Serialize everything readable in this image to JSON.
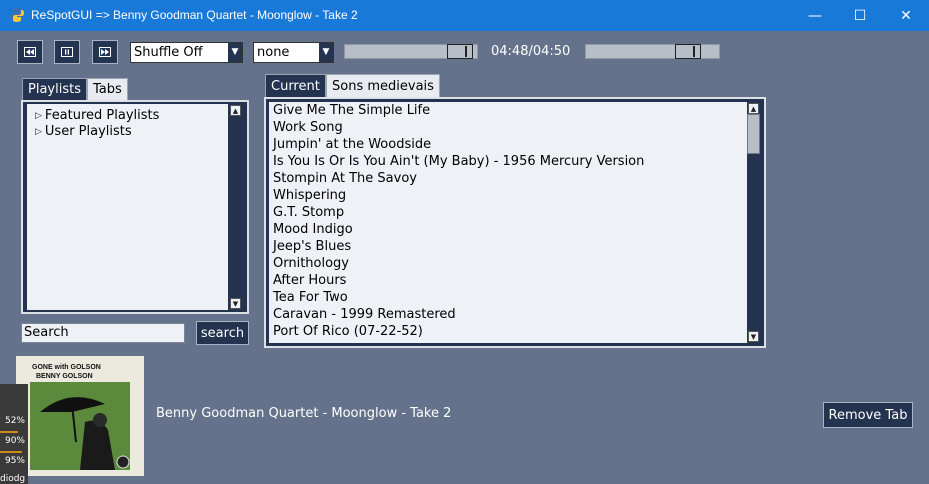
{
  "window": {
    "title": "ReSpotGUI => Benny Goodman Quartet - Moonglow - Take 2",
    "controls": {
      "minimize": "—",
      "maximize": "☐",
      "close": "✕"
    }
  },
  "toolbar": {
    "prev_icon": "rewind-icon",
    "pause_icon": "pause-icon",
    "next_icon": "fast-forward-icon",
    "shuffle_value": "Shuffle Off",
    "repeat_value": "none",
    "progress_fraction": 0.96,
    "time_display": "04:48/04:50",
    "volume_fraction": 0.83
  },
  "left_panel": {
    "tabs": [
      {
        "label": "Playlists",
        "active": true
      },
      {
        "label": "Tabs",
        "active": false
      }
    ],
    "tree": [
      {
        "label": "Featured Playlists"
      },
      {
        "label": "User Playlists"
      }
    ],
    "search": {
      "value": "Search",
      "button_label": "search"
    }
  },
  "right_panel": {
    "tabs": [
      {
        "label": "Current",
        "active": true
      },
      {
        "label": "Sons medievais",
        "active": false
      }
    ],
    "tracks": [
      "Give Me The Simple Life",
      "Work Song",
      "Jumpin' at the Woodside",
      "Is You Is Or Is You Ain't (My Baby) - 1956 Mercury Version",
      "Stompin At The Savoy",
      "Whispering",
      "G.T. Stomp",
      "Mood Indigo",
      "Jeep's Blues",
      "Ornithology",
      "After Hours",
      "Tea For Two",
      "Caravan - 1999 Remastered",
      "Port Of Rico (07-22-52)"
    ]
  },
  "album": {
    "title_line1": "GONE with GOLSON",
    "title_line2": "BENNY GOLSON"
  },
  "now_playing": "Benny Goodman Quartet - Moonglow - Take 2",
  "remove_tab_label": "Remove Tab",
  "side_overlay": {
    "stats": [
      "52%",
      "90%",
      "95%"
    ],
    "label": "diodg"
  },
  "colors": {
    "titlebar": "#1979d8",
    "background": "#64738b",
    "dark_accent": "#233350",
    "list_bg": "#eef1f6"
  }
}
